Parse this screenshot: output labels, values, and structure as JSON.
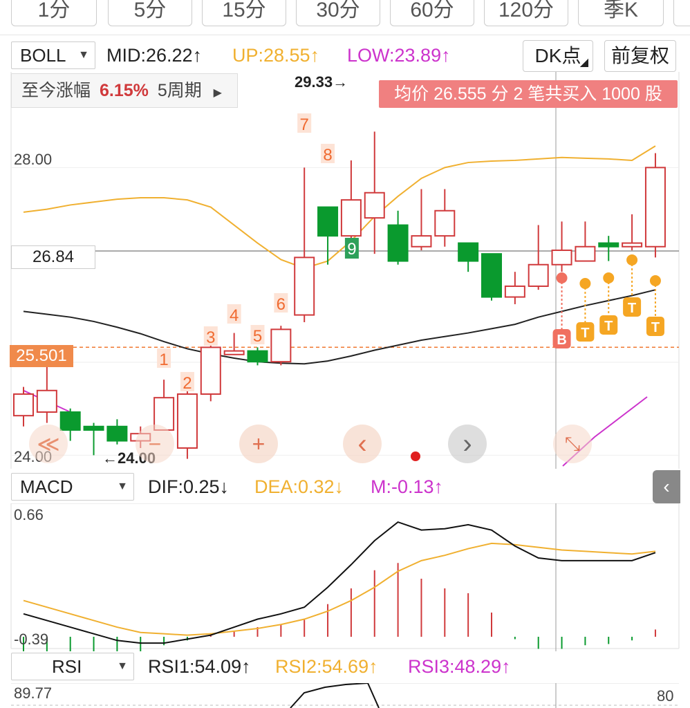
{
  "period_tabs": [
    "1分",
    "5分",
    "15分",
    "30分",
    "60分",
    "120分",
    "季K"
  ],
  "boll": {
    "selector": "BOLL",
    "mid": "MID:26.22",
    "up": "UP:28.55",
    "low": "LOW:23.89",
    "arrow": "↑",
    "dk_button": "DK点",
    "fq_button": "前复权"
  },
  "info": {
    "label": "至今涨幅",
    "pct": "6.15%",
    "period": "5周期"
  },
  "avg_banner": "均价 26.555 分 2 笔共买入 1000 股",
  "price_labels": {
    "high_marker": "29.33",
    "p28": "28.00",
    "crosshair_price": "26.84",
    "dashed_price": "25.501",
    "p24": "24.00",
    "low_marker": "24.00"
  },
  "seq_numbers": [
    "1",
    "2",
    "3",
    "4",
    "5",
    "6",
    "7",
    "8"
  ],
  "green_nine": "9",
  "signal_b": "B",
  "signal_t": "T",
  "nav": {
    "rewind": "≪",
    "minus": "−",
    "plus": "+",
    "prev": "‹",
    "next": "›",
    "expand": "⤡"
  },
  "macd": {
    "selector": "MACD",
    "dif": "DIF:0.25",
    "dea": "DEA:0.32",
    "m": "M:-0.13",
    "dif_arrow": "↓",
    "dea_arrow": "↓",
    "m_arrow": "↑",
    "top": "0.66",
    "bottom": "-0.39"
  },
  "rsi": {
    "selector": "RSI",
    "rsi1": "RSI1:54.09",
    "rsi2": "RSI2:54.69",
    "rsi3": "RSI3:48.29",
    "arrow": "↑",
    "top": "89.77",
    "right": "80"
  },
  "colors": {
    "up": "#d0393b",
    "down": "#0a9a2e",
    "mid_line": "#222222",
    "upper_line": "#f0b030",
    "lower_line": "#cc33cc",
    "signal": "#f5a623",
    "dashed": "#f07830"
  },
  "chart_data": {
    "type": "candlestick",
    "candles": [
      {
        "o": 24.55,
        "c": 24.85,
        "h": 24.95,
        "l": 24.4
      },
      {
        "o": 24.6,
        "c": 24.9,
        "h": 25.4,
        "l": 24.45
      },
      {
        "o": 24.6,
        "c": 24.35,
        "h": 24.65,
        "l": 24.2
      },
      {
        "o": 24.4,
        "c": 24.35,
        "h": 24.45,
        "l": 24.0
      },
      {
        "o": 24.4,
        "c": 24.2,
        "h": 24.5,
        "l": 24.15
      },
      {
        "o": 24.2,
        "c": 24.3,
        "h": 24.4,
        "l": 24.1
      },
      {
        "o": 24.35,
        "c": 24.8,
        "h": 25.05,
        "l": 24.35
      },
      {
        "o": 24.1,
        "c": 24.85,
        "h": 24.9,
        "l": 23.95
      },
      {
        "o": 24.85,
        "c": 25.5,
        "h": 25.65,
        "l": 24.75
      },
      {
        "o": 25.4,
        "c": 25.45,
        "h": 25.7,
        "l": 25.4
      },
      {
        "o": 25.45,
        "c": 25.3,
        "h": 25.5,
        "l": 25.25
      },
      {
        "o": 25.3,
        "c": 25.75,
        "h": 25.8,
        "l": 25.25
      },
      {
        "o": 25.95,
        "c": 26.75,
        "h": 28.0,
        "l": 25.85
      },
      {
        "o": 27.45,
        "c": 27.05,
        "h": 27.45,
        "l": 26.65
      },
      {
        "o": 27.05,
        "c": 27.55,
        "h": 28.1,
        "l": 26.95
      },
      {
        "o": 27.3,
        "c": 27.65,
        "h": 28.5,
        "l": 26.8
      },
      {
        "o": 27.2,
        "c": 26.7,
        "h": 27.4,
        "l": 26.65
      },
      {
        "o": 26.9,
        "c": 27.05,
        "h": 27.7,
        "l": 26.85
      },
      {
        "o": 27.05,
        "c": 27.4,
        "h": 27.7,
        "l": 26.9
      },
      {
        "o": 26.95,
        "c": 26.7,
        "h": 26.95,
        "l": 26.55
      },
      {
        "o": 26.8,
        "c": 26.2,
        "h": 26.8,
        "l": 26.15
      },
      {
        "o": 26.2,
        "c": 26.35,
        "h": 26.55,
        "l": 26.1
      },
      {
        "o": 26.35,
        "c": 26.65,
        "h": 27.2,
        "l": 26.3
      },
      {
        "o": 26.65,
        "c": 26.85,
        "h": 27.25,
        "l": 26.55
      },
      {
        "o": 26.7,
        "c": 26.9,
        "h": 27.25,
        "l": 26.7
      },
      {
        "o": 26.95,
        "c": 26.9,
        "h": 27.05,
        "l": 26.7
      },
      {
        "o": 26.9,
        "c": 26.95,
        "h": 27.35,
        "l": 26.85
      },
      {
        "o": 26.9,
        "c": 28.0,
        "h": 28.2,
        "l": 26.75
      }
    ],
    "boll_mid": [
      26.0,
      25.96,
      25.92,
      25.86,
      25.78,
      25.69,
      25.58,
      25.48,
      25.41,
      25.35,
      25.3,
      25.28,
      25.27,
      25.31,
      25.38,
      25.46,
      25.53,
      25.6,
      25.65,
      25.7,
      25.76,
      25.82,
      25.92,
      26.0,
      26.08,
      26.15,
      26.22,
      26.3
    ],
    "boll_up": [
      27.38,
      27.42,
      27.48,
      27.52,
      27.56,
      27.58,
      27.58,
      27.55,
      27.45,
      27.2,
      26.95,
      26.72,
      26.6,
      26.7,
      26.98,
      27.32,
      27.6,
      27.85,
      28.0,
      28.07,
      28.09,
      28.1,
      28.12,
      28.14,
      28.13,
      28.12,
      28.1,
      28.3
    ],
    "boll_low": [
      24.9,
      24.75,
      24.6
    ],
    "y_range": [
      23.85,
      29.33
    ],
    "macd": {
      "range": [
        -0.39,
        0.66
      ],
      "dif": [
        -0.15,
        -0.2,
        -0.25,
        -0.3,
        -0.35,
        -0.37,
        -0.37,
        -0.34,
        -0.31,
        -0.25,
        -0.19,
        -0.15,
        -0.1,
        0.05,
        0.22,
        0.4,
        0.54,
        0.48,
        0.49,
        0.52,
        0.48,
        0.36,
        0.27,
        0.25,
        0.25,
        0.25,
        0.25,
        0.31
      ],
      "dea": [
        -0.05,
        -0.1,
        -0.15,
        -0.2,
        -0.25,
        -0.29,
        -0.3,
        -0.31,
        -0.3,
        -0.28,
        -0.26,
        -0.23,
        -0.19,
        -0.13,
        -0.05,
        0.05,
        0.17,
        0.25,
        0.29,
        0.34,
        0.38,
        0.37,
        0.35,
        0.33,
        0.32,
        0.31,
        0.3,
        0.32
      ],
      "m": [
        -0.28,
        -0.26,
        -0.24,
        -0.22,
        -0.2,
        -0.16,
        -0.07,
        -0.03,
        0.02,
        0.05,
        0.08,
        0.1,
        0.14,
        0.27,
        0.4,
        0.55,
        0.61,
        0.48,
        0.4,
        0.36,
        0.2,
        -0.02,
        -0.1,
        -0.1,
        -0.07,
        -0.06,
        -0.03,
        0.06
      ]
    },
    "rsi1_partial": [
      78,
      82,
      86,
      88,
      89,
      89
    ]
  }
}
